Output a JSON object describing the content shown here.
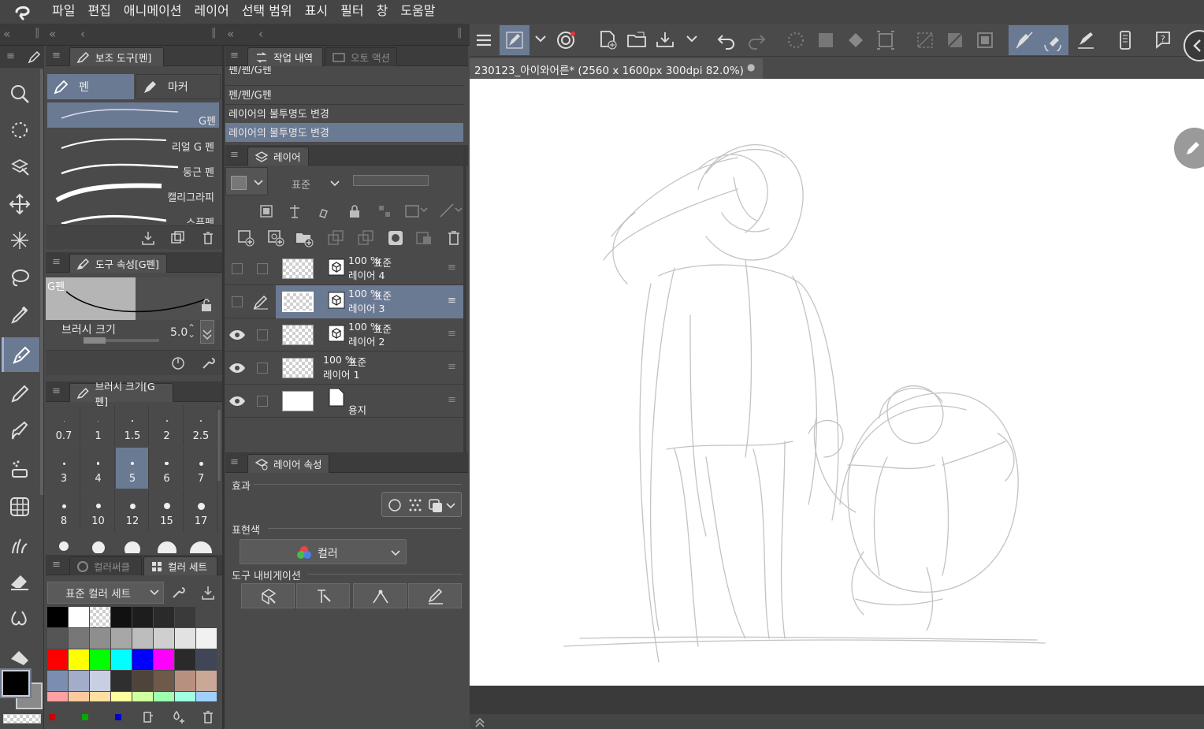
{
  "menu": [
    "파일",
    "편집",
    "애니메이션",
    "레이어",
    "선택 범위",
    "표시",
    "필터",
    "창",
    "도움말"
  ],
  "panels": {
    "sub_tool": {
      "title": "보조 도구[펜]",
      "tab_pen": "펜",
      "tab_marker": "마커",
      "brushes": [
        "G펜",
        "리얼 G 펜",
        "둥근 펜",
        "캘리그라피",
        "스푸펜"
      ]
    },
    "tool_property": {
      "title": "도구 속성[G펜]",
      "preview_label": "G펜",
      "brush_size_label": "브러시 크기",
      "brush_size_value": "5.0"
    },
    "brush_size": {
      "title": "브러시 크기[G펜]",
      "sizes": [
        "0.7",
        "1",
        "1.5",
        "2",
        "2.5",
        "3",
        "4",
        "5",
        "6",
        "7",
        "8",
        "10",
        "12",
        "15",
        "17"
      ],
      "selected": "5"
    },
    "color": {
      "tab_wheel": "컬러써클",
      "tab_set": "컬러 세트",
      "set_name": "표준 컬러 세트"
    },
    "history": {
      "tab_history": "작업 내역",
      "tab_auto": "오토 액션",
      "items": [
        "펜/펜/G펜",
        "펜/펜/G펜",
        "레이어의 불투명도 변경",
        "레이어의 불투명도 변경"
      ]
    },
    "layer": {
      "title": "레이어",
      "blend_mode": "표준",
      "layers": [
        {
          "percent": "100 %",
          "mode": "표준",
          "name": "레이어 4"
        },
        {
          "percent": "100 %",
          "mode": "표준",
          "name": "레이어 3"
        },
        {
          "percent": "100 %",
          "mode": "표준",
          "name": "레이어 2"
        },
        {
          "percent": "100 %",
          "mode": "표준",
          "name": "레이어 1"
        },
        {
          "percent": "",
          "mode": "",
          "name": "용지"
        }
      ]
    },
    "layer_property": {
      "title": "레이어 속성",
      "effect_label": "효과",
      "expression_label": "표현색",
      "expression_value": "컬러",
      "tool_nav_label": "도구 내비게이션"
    }
  },
  "document": {
    "title": "230123_아이와어른* (2560 x 1600px 300dpi 82.0%)"
  },
  "colors": {
    "accent_selected": "#6b7a93",
    "panel_bg": "#4a4a4a",
    "header_bg": "#3c3c3c",
    "main_color": "#000000",
    "sub_color": "#8a8a8a"
  },
  "swatches": [
    [
      "#000000",
      "#ffffff",
      "checker",
      "#111111",
      "#1d1d1d",
      "#2a2a2a",
      "#3a3a3a",
      "#4a4a4a"
    ],
    [
      "#555555",
      "#777777",
      "#8e8e8e",
      "#a7a7a7",
      "#bdbdbd",
      "#cfcfcf",
      "#e2e2e2",
      "#f1f1f1"
    ],
    [
      "#ff0000",
      "#ffff00",
      "#00ff00",
      "#00ffff",
      "#0000ff",
      "#ff00ff",
      "#2a2a2a",
      "#404658"
    ],
    [
      "#7b8db0",
      "#a3acc8",
      "#c9cfe2",
      "#2f2f2f",
      "#4e443c",
      "#6e5a48",
      "#b89080",
      "#c9a898"
    ],
    [
      "#ff9f9f",
      "#ffc9a0",
      "#ffe0a0",
      "#ffff9f",
      "#cfff9f",
      "#9fffb0",
      "#9fffe0",
      "#9fd0ff"
    ]
  ]
}
